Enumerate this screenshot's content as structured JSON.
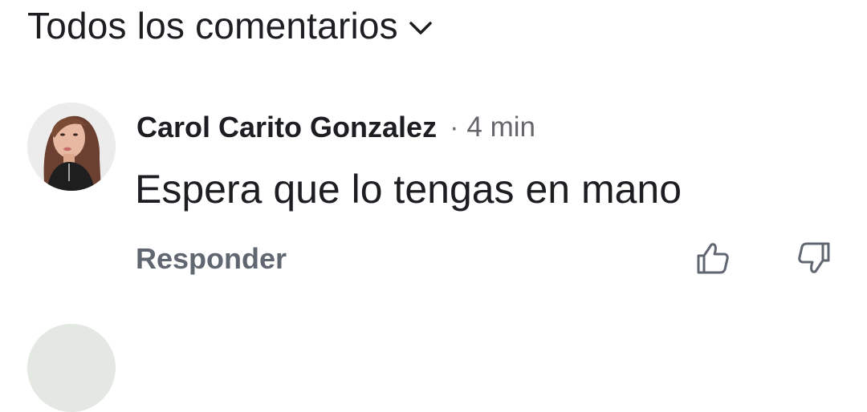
{
  "comments_header": {
    "filter_label": "Todos los comentarios",
    "chevron_icon": "chevron-down-icon"
  },
  "comment": {
    "author": "Carol Carito Gonzalez",
    "separator": "·",
    "time": "4 min",
    "text": "Espera que lo tengas en mano",
    "reply_label": "Responder",
    "upvote_icon": "thumbs-up-icon",
    "downvote_icon": "thumbs-down-icon"
  },
  "colors": {
    "text_primary": "#1c1e21",
    "text_secondary": "#65676b",
    "background": "#ffffff"
  }
}
